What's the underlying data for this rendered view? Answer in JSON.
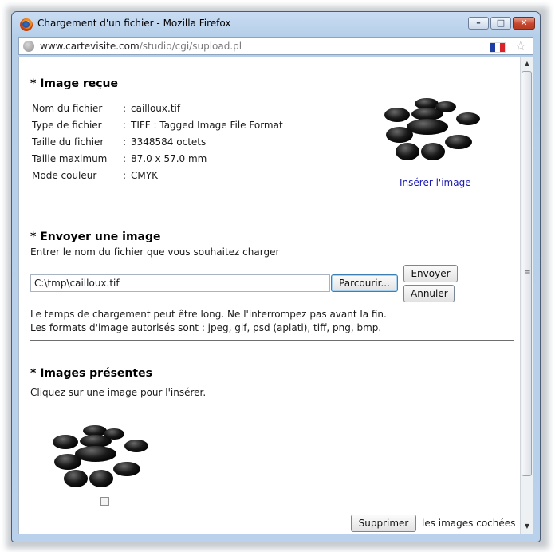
{
  "window": {
    "title": "Chargement d'un fichier - Mozilla Firefox",
    "controls": {
      "minimize": "–",
      "maximize": "□",
      "close": "✕"
    },
    "url_domain": "www.cartevisite.com",
    "url_path": "/studio/cgi/supload.pl",
    "flag_colors": [
      "#1f3fa6",
      "#ffffff",
      "#d8232a"
    ],
    "star_icon": "☆"
  },
  "received": {
    "heading": "* Image reçue",
    "rows": [
      {
        "key": "Nom du fichier",
        "sep": ":",
        "value": "cailloux.tif"
      },
      {
        "key": "Type de fichier",
        "sep": ":",
        "value": "TIFF : Tagged Image File Format"
      },
      {
        "key": "Taille du fichier",
        "sep": ":",
        "value": "3348584 octets"
      },
      {
        "key": "Taille maximum",
        "sep": ":",
        "value": "87.0 x 57.0 mm"
      },
      {
        "key": "Mode couleur",
        "sep": ":",
        "value": "CMYK"
      }
    ],
    "insert_link": "Insérer l'image"
  },
  "send": {
    "heading": "* Envoyer une image",
    "instruction": "Entrer le nom du fichier que vous souhaitez charger",
    "file_value": "C:\\tmp\\cailloux.tif",
    "browse_label": "Parcourir...",
    "send_label": "Envoyer",
    "cancel_label": "Annuler",
    "note1": "Le temps de chargement peut être long. Ne l'interrompez pas avant la fin.",
    "note2": "Les formats d'image autorisés sont : jpeg, gif, psd (aplati), tiff, png, bmp."
  },
  "present": {
    "heading": "* Images présentes",
    "instruction": "Cliquez sur une image pour l'insérer.",
    "checkbox_checked": false,
    "delete_label": "Supprimer",
    "delete_suffix": "les images cochées"
  }
}
